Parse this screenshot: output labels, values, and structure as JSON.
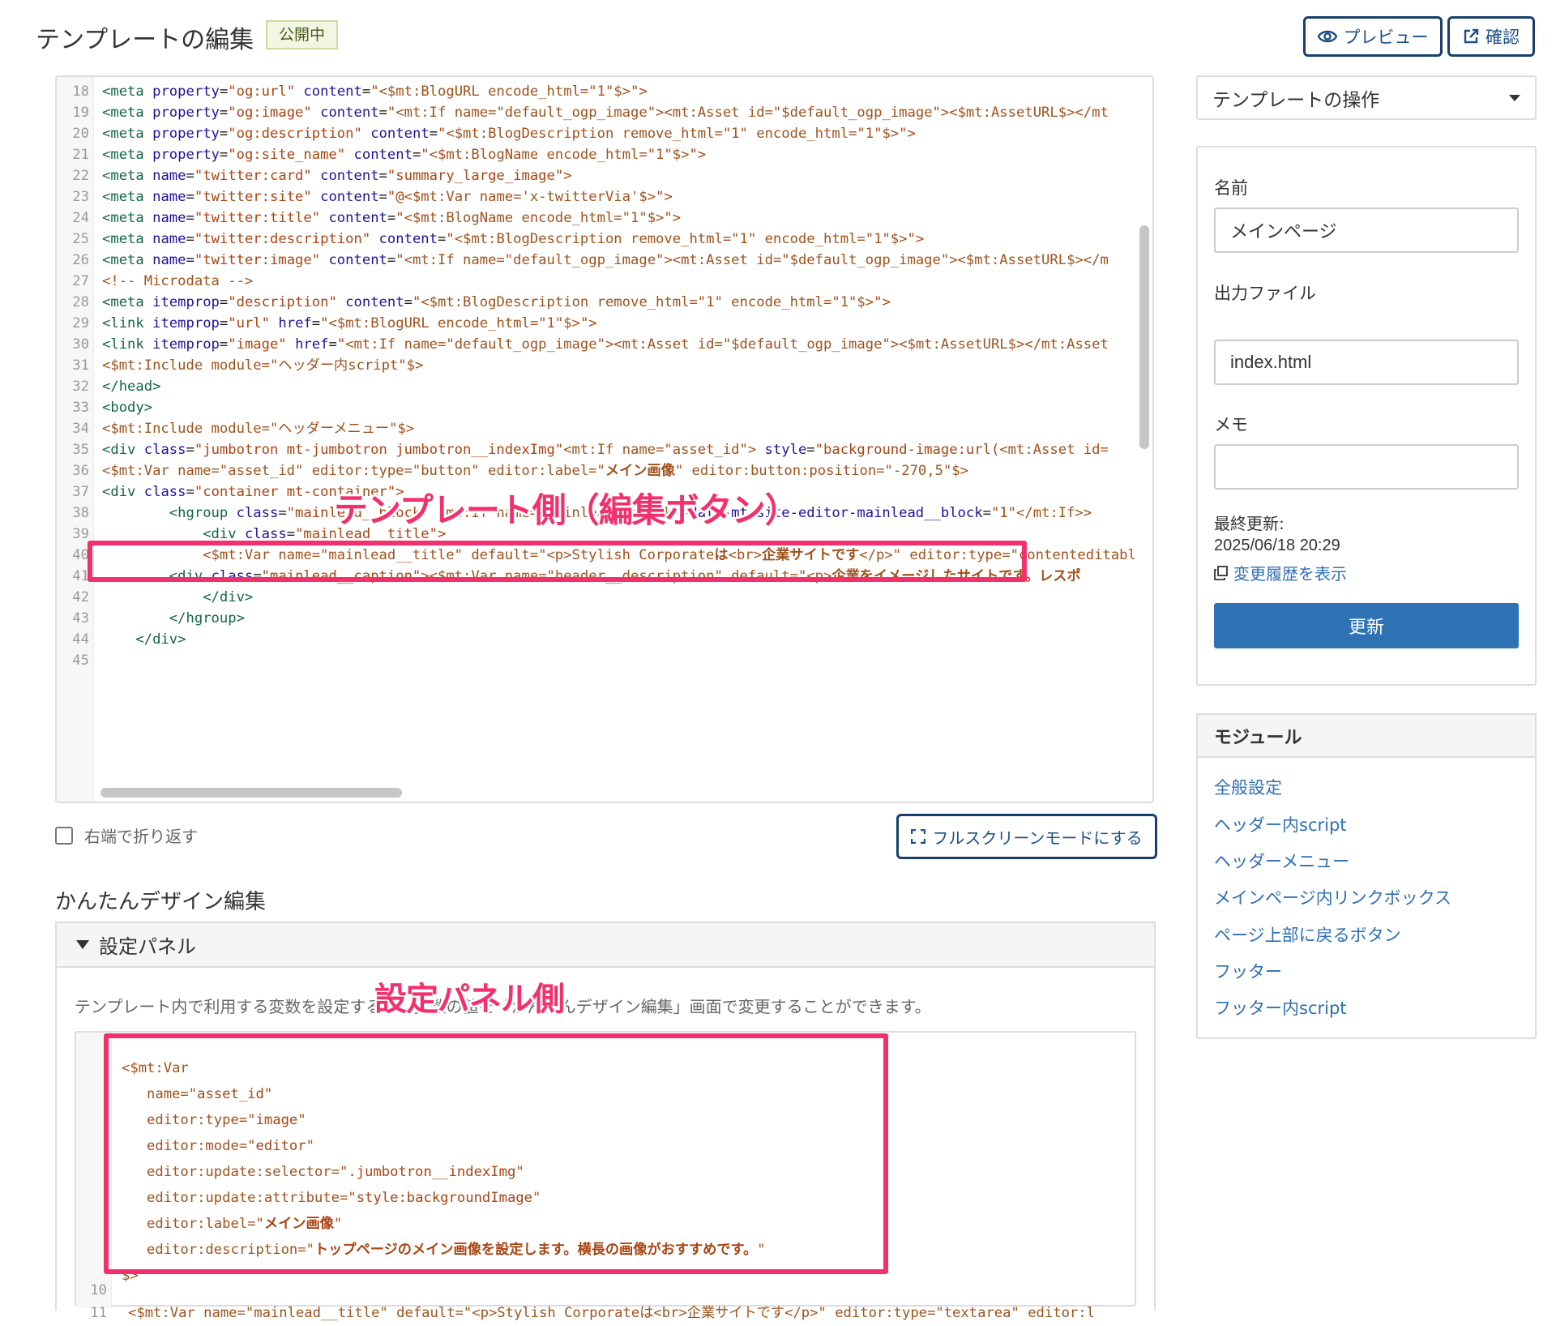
{
  "header": {
    "title": "テンプレートの編集",
    "status_badge": "公開中",
    "preview_label": "プレビュー",
    "confirm_label": "確認"
  },
  "editor": {
    "lines": [
      {
        "n": "18",
        "i": 0,
        "t": [
          [
            "t",
            "<meta"
          ],
          [
            "p",
            " "
          ],
          [
            "a",
            "property"
          ],
          [
            "p",
            "="
          ],
          [
            "s",
            "\"og:url\""
          ],
          [
            "p",
            " "
          ],
          [
            "a",
            "content"
          ],
          [
            "p",
            "="
          ],
          [
            "s",
            "\""
          ],
          [
            "m",
            "<$mt:BlogURL encode_html=\"1\"$>"
          ],
          [
            "s",
            "\">"
          ]
        ]
      },
      {
        "n": "19",
        "i": 0,
        "t": [
          [
            "t",
            "<meta"
          ],
          [
            "p",
            " "
          ],
          [
            "a",
            "property"
          ],
          [
            "p",
            "="
          ],
          [
            "s",
            "\"og:image\""
          ],
          [
            "p",
            " "
          ],
          [
            "a",
            "content"
          ],
          [
            "p",
            "="
          ],
          [
            "s",
            "\""
          ],
          [
            "m",
            "<mt:If name=\"default_ogp_image\"><mt:Asset id=\"$default_ogp_image\"><$mt:AssetURL$></mt"
          ]
        ]
      },
      {
        "n": "20",
        "i": 0,
        "t": [
          [
            "t",
            "<meta"
          ],
          [
            "p",
            " "
          ],
          [
            "a",
            "property"
          ],
          [
            "p",
            "="
          ],
          [
            "s",
            "\"og:description\""
          ],
          [
            "p",
            " "
          ],
          [
            "a",
            "content"
          ],
          [
            "p",
            "="
          ],
          [
            "s",
            "\""
          ],
          [
            "m",
            "<$mt:BlogDescription remove_html=\"1\" encode_html=\"1\"$>"
          ],
          [
            "s",
            "\">"
          ]
        ]
      },
      {
        "n": "21",
        "i": 0,
        "t": [
          [
            "t",
            "<meta"
          ],
          [
            "p",
            " "
          ],
          [
            "a",
            "property"
          ],
          [
            "p",
            "="
          ],
          [
            "s",
            "\"og:site_name\""
          ],
          [
            "p",
            " "
          ],
          [
            "a",
            "content"
          ],
          [
            "p",
            "="
          ],
          [
            "s",
            "\""
          ],
          [
            "m",
            "<$mt:BlogName encode_html=\"1\"$>"
          ],
          [
            "s",
            "\">"
          ]
        ]
      },
      {
        "n": "22",
        "i": 0,
        "t": [
          [
            "t",
            "<meta"
          ],
          [
            "p",
            " "
          ],
          [
            "a",
            "name"
          ],
          [
            "p",
            "="
          ],
          [
            "s",
            "\"twitter:card\""
          ],
          [
            "p",
            " "
          ],
          [
            "a",
            "content"
          ],
          [
            "p",
            "="
          ],
          [
            "s",
            "\"summary_large_image\">"
          ]
        ]
      },
      {
        "n": "23",
        "i": 0,
        "t": [
          [
            "t",
            "<meta"
          ],
          [
            "p",
            " "
          ],
          [
            "a",
            "name"
          ],
          [
            "p",
            "="
          ],
          [
            "s",
            "\"twitter:site\""
          ],
          [
            "p",
            " "
          ],
          [
            "a",
            "content"
          ],
          [
            "p",
            "="
          ],
          [
            "s",
            "\"@"
          ],
          [
            "m",
            "<$mt:Var name='x-twitterVia'$>"
          ],
          [
            "s",
            "\">"
          ]
        ]
      },
      {
        "n": "24",
        "i": 0,
        "t": [
          [
            "t",
            "<meta"
          ],
          [
            "p",
            " "
          ],
          [
            "a",
            "name"
          ],
          [
            "p",
            "="
          ],
          [
            "s",
            "\"twitter:title\""
          ],
          [
            "p",
            " "
          ],
          [
            "a",
            "content"
          ],
          [
            "p",
            "="
          ],
          [
            "s",
            "\""
          ],
          [
            "m",
            "<$mt:BlogName encode_html=\"1\"$>"
          ],
          [
            "s",
            "\">"
          ]
        ]
      },
      {
        "n": "25",
        "i": 0,
        "t": [
          [
            "t",
            "<meta"
          ],
          [
            "p",
            " "
          ],
          [
            "a",
            "name"
          ],
          [
            "p",
            "="
          ],
          [
            "s",
            "\"twitter:description\""
          ],
          [
            "p",
            " "
          ],
          [
            "a",
            "content"
          ],
          [
            "p",
            "="
          ],
          [
            "s",
            "\""
          ],
          [
            "m",
            "<$mt:BlogDescription remove_html=\"1\" encode_html=\"1\"$>"
          ],
          [
            "s",
            "\">"
          ]
        ]
      },
      {
        "n": "26",
        "i": 0,
        "t": [
          [
            "t",
            "<meta"
          ],
          [
            "p",
            " "
          ],
          [
            "a",
            "name"
          ],
          [
            "p",
            "="
          ],
          [
            "s",
            "\"twitter:image\""
          ],
          [
            "p",
            " "
          ],
          [
            "a",
            "content"
          ],
          [
            "p",
            "="
          ],
          [
            "s",
            "\""
          ],
          [
            "m",
            "<mt:If name=\"default_ogp_image\"><mt:Asset id=\"$default_ogp_image\"><$mt:AssetURL$></m"
          ]
        ]
      },
      {
        "n": "27",
        "i": 0,
        "t": [
          [
            "c",
            "<!-- Microdata -->"
          ]
        ]
      },
      {
        "n": "28",
        "i": 0,
        "t": [
          [
            "t",
            "<meta"
          ],
          [
            "p",
            " "
          ],
          [
            "a",
            "itemprop"
          ],
          [
            "p",
            "="
          ],
          [
            "s",
            "\"description\""
          ],
          [
            "p",
            " "
          ],
          [
            "a",
            "content"
          ],
          [
            "p",
            "="
          ],
          [
            "s",
            "\""
          ],
          [
            "m",
            "<$mt:BlogDescription remove_html=\"1\" encode_html=\"1\"$>"
          ],
          [
            "s",
            "\">"
          ]
        ]
      },
      {
        "n": "29",
        "i": 0,
        "t": [
          [
            "t",
            "<link"
          ],
          [
            "p",
            " "
          ],
          [
            "a",
            "itemprop"
          ],
          [
            "p",
            "="
          ],
          [
            "s",
            "\"url\""
          ],
          [
            "p",
            " "
          ],
          [
            "a",
            "href"
          ],
          [
            "p",
            "="
          ],
          [
            "s",
            "\""
          ],
          [
            "m",
            "<$mt:BlogURL encode_html=\"1\"$>"
          ],
          [
            "s",
            "\">"
          ]
        ]
      },
      {
        "n": "30",
        "i": 0,
        "t": [
          [
            "t",
            "<link"
          ],
          [
            "p",
            " "
          ],
          [
            "a",
            "itemprop"
          ],
          [
            "p",
            "="
          ],
          [
            "s",
            "\"image\""
          ],
          [
            "p",
            " "
          ],
          [
            "a",
            "href"
          ],
          [
            "p",
            "="
          ],
          [
            "s",
            "\""
          ],
          [
            "m",
            "<mt:If name=\"default_ogp_image\"><mt:Asset id=\"$default_ogp_image\"><$mt:AssetURL$></mt:Asset"
          ]
        ]
      },
      {
        "n": "31",
        "i": 0,
        "t": [
          [
            "m",
            "<$mt:Include module=\"ヘッダー内script\"$>"
          ]
        ]
      },
      {
        "n": "32",
        "i": 0,
        "t": [
          [
            "t",
            "</head>"
          ]
        ]
      },
      {
        "n": "33",
        "i": 0,
        "t": [
          [
            "t",
            "<body>"
          ]
        ]
      },
      {
        "n": "34",
        "i": 0,
        "t": [
          [
            "m",
            "<$mt:Include module=\"ヘッダーメニュー\"$>"
          ]
        ]
      },
      {
        "n": "35",
        "i": 0,
        "t": [
          [
            "t",
            "<div"
          ],
          [
            "p",
            " "
          ],
          [
            "a",
            "class"
          ],
          [
            "p",
            "="
          ],
          [
            "s",
            "\"jumbotron mt-jumbotron jumbotron__indexImg\""
          ],
          [
            "m",
            "<mt:If name=\"asset_id\">"
          ],
          [
            "p",
            " "
          ],
          [
            "a",
            "style"
          ],
          [
            "p",
            "="
          ],
          [
            "s",
            "\"background-image:url("
          ],
          [
            "m",
            "<mt:Asset id="
          ]
        ]
      },
      {
        "n": "36",
        "i": 0,
        "t": [
          [
            "m",
            "<$mt:Var name=\"asset_id\" editor:type=\"button\" editor:label=\""
          ],
          [
            "mb",
            "メイン画像"
          ],
          [
            "m",
            "\" editor:button:position=\"-270,5\"$>"
          ]
        ]
      },
      {
        "n": "37",
        "i": 0,
        "t": [
          [
            "t",
            "<div"
          ],
          [
            "p",
            " "
          ],
          [
            "a",
            "class"
          ],
          [
            "p",
            "="
          ],
          [
            "s",
            "\"container mt-container\">"
          ]
        ]
      },
      {
        "n": "38",
        "i": 2,
        "t": [
          [
            "t",
            "<hgroup"
          ],
          [
            "p",
            " "
          ],
          [
            "a",
            "class"
          ],
          [
            "p",
            "="
          ],
          [
            "s",
            "\"mainlead__block\""
          ],
          [
            "p",
            " "
          ],
          [
            "m",
            "<mt:If name=\"mainlead__block\">"
          ],
          [
            "a",
            "data-mt-site-editor-mainlead__block"
          ],
          [
            "p",
            "="
          ],
          [
            "s",
            "\"1\""
          ],
          [
            "m",
            "</mt:If>"
          ],
          [
            "s",
            ">"
          ]
        ]
      },
      {
        "n": "39",
        "i": 3,
        "t": [
          [
            "t",
            "<div"
          ],
          [
            "p",
            " "
          ],
          [
            "a",
            "class"
          ],
          [
            "p",
            "="
          ],
          [
            "s",
            "\"mainlead__title\">"
          ]
        ]
      },
      {
        "n": "40",
        "i": 3,
        "t": [
          [
            "m",
            "<$mt:Var name=\"mainlead__title\" default=\"<p>Stylish Corporate"
          ],
          [
            "mb",
            "は"
          ],
          [
            "m",
            "<br>"
          ],
          [
            "mb",
            "企業サイトです"
          ],
          [
            "m",
            "</p>\" editor:type=\"contenteditable"
          ]
        ]
      },
      {
        "n": "41",
        "i": 2,
        "t": [
          [
            "t",
            "<div"
          ],
          [
            "p",
            " "
          ],
          [
            "a",
            "class"
          ],
          [
            "p",
            "="
          ],
          [
            "s",
            "\"mainlead__caption\">"
          ],
          [
            "m",
            "<$mt:Var name=\"header__description\" default=\"<p>"
          ],
          [
            "mb",
            "企業をイメージしたサイトです。レスポ"
          ]
        ]
      },
      {
        "n": "42",
        "i": 3,
        "t": [
          [
            "t",
            "</div>"
          ]
        ]
      },
      {
        "n": "43",
        "i": 2,
        "t": [
          [
            "t",
            "</hgroup>"
          ]
        ]
      },
      {
        "n": "44",
        "i": 1,
        "t": [
          [
            "t",
            "</div>"
          ]
        ]
      },
      {
        "n": "45",
        "i": 0,
        "t": []
      }
    ]
  },
  "overlays": {
    "template_side": "テンプレート側（編集ボタン）",
    "panel_side": "設定パネル側"
  },
  "wrap_option": {
    "label": "右端で折り返す",
    "checked": false
  },
  "fullscreen_label": "フルスクリーンモードにする",
  "easy_design": {
    "title": "かんたんデザイン編集",
    "panel_title": "設定パネル",
    "description": "テンプレート内で利用する変数を設定すると、変数の値を「かんたんデザイン編集」画面で変更することができます。",
    "lines": [
      {
        "i": 0,
        "t": [
          [
            "m",
            "<$mt:Var"
          ]
        ]
      },
      {
        "i": 1,
        "t": [
          [
            "m",
            "name=\""
          ],
          [
            "s",
            "asset_id"
          ],
          [
            "m",
            "\""
          ]
        ]
      },
      {
        "i": 1,
        "t": [
          [
            "m",
            "editor:type=\""
          ],
          [
            "s",
            "image"
          ],
          [
            "m",
            "\""
          ]
        ]
      },
      {
        "i": 1,
        "t": [
          [
            "m",
            "editor:mode=\""
          ],
          [
            "s",
            "editor"
          ],
          [
            "m",
            "\""
          ]
        ]
      },
      {
        "i": 1,
        "t": [
          [
            "m",
            "editor:update:selector=\""
          ],
          [
            "s",
            ".jumbotron__indexImg"
          ],
          [
            "m",
            "\""
          ]
        ]
      },
      {
        "i": 1,
        "t": [
          [
            "m",
            "editor:update:attribute=\""
          ],
          [
            "s",
            "style:backgroundImage"
          ],
          [
            "m",
            "\""
          ]
        ]
      },
      {
        "i": 1,
        "t": [
          [
            "m",
            "editor:label=\""
          ],
          [
            "sb",
            "メイン画像"
          ],
          [
            "m",
            "\""
          ]
        ]
      },
      {
        "i": 1,
        "t": [
          [
            "m",
            "editor:description=\""
          ],
          [
            "sb",
            "トップページのメイン画像を設定します。横長の画像がおすすめです。"
          ],
          [
            "m",
            "\""
          ]
        ]
      },
      {
        "i": 0,
        "t": [
          [
            "m",
            "$>"
          ]
        ]
      }
    ],
    "line_10_number": "10",
    "line_11_number": "11",
    "line_11_text": "<$mt:Var name=\"mainlead__title\" default=\"<p>Stylish Corporateは<br>企業サイトです</p>\" editor:type=\"textarea\" editor:l"
  },
  "sidebar": {
    "operations_label": "テンプレートの操作",
    "name_label": "名前",
    "name_value": "メインページ",
    "output_label": "出力ファイル",
    "output_value": "index.html",
    "memo_label": "メモ",
    "memo_value": "",
    "last_updated_label": "最終更新:",
    "last_updated_value": "2025/06/18 20:29",
    "history_link": "変更履歴を表示",
    "update_label": "更新",
    "modules_title": "モジュール",
    "modules": [
      "全般設定",
      "ヘッダー内script",
      "ヘッダーメニュー",
      "メインページ内リンクボックス",
      "ページ上部に戻るボタン",
      "フッター",
      "フッター内script"
    ]
  },
  "colors": {
    "accent": "#2f73b5",
    "highlight": "#f2306d",
    "dark_button_border": "#173f6b"
  },
  "icons": {
    "preview": "eye-icon",
    "confirm": "external-link-icon",
    "fullscreen": "expand-icon",
    "history": "copy-icon",
    "dropdown": "caret-down-icon"
  }
}
